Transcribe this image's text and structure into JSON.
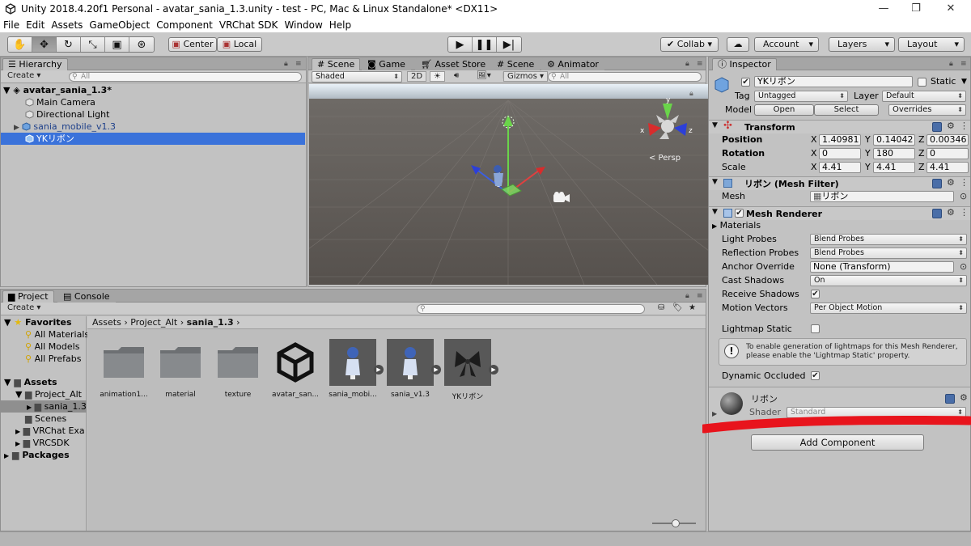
{
  "window": {
    "title": "Unity 2018.4.20f1 Personal - avatar_sania_1.3.unity - test - PC, Mac & Linux Standalone* <DX11>"
  },
  "menu": [
    "File",
    "Edit",
    "Assets",
    "GameObject",
    "Component",
    "VRChat SDK",
    "Window",
    "Help"
  ],
  "toolbar": {
    "center_label": "Center",
    "local_label": "Local",
    "collab_label": "Collab ▾",
    "account_label": "Account",
    "layers_label": "Layers",
    "layout_label": "Layout"
  },
  "hierarchy": {
    "tab": "Hierarchy",
    "create": "Create ▾",
    "search_placeholder": "All",
    "scene": "avatar_sania_1.3*",
    "items": [
      {
        "label": "Main Camera"
      },
      {
        "label": "Directional Light"
      },
      {
        "label": "sania_mobile_v1.3"
      },
      {
        "label": "YKリボン"
      }
    ]
  },
  "scene": {
    "tabs": [
      "Scene",
      "Game",
      "Asset Store",
      "Scene",
      "Animator"
    ],
    "shading": "Shaded",
    "mode2d": "2D",
    "gizmos": "Gizmos ▾",
    "search_placeholder": "All",
    "persp": "< Persp",
    "axis_x": "x",
    "axis_y": "y",
    "axis_z": "z"
  },
  "project": {
    "tabs": [
      "Project",
      "Console"
    ],
    "create": "Create ▾",
    "favorites": "Favorites",
    "fav_items": [
      "All Materials",
      "All Models",
      "All Prefabs"
    ],
    "assets_root": "Assets",
    "tree": [
      "Project_Alt",
      "sania_1.3",
      "Scenes",
      "VRChat Exa",
      "VRCSDK"
    ],
    "packages": "Packages",
    "breadcrumb": [
      "Assets",
      "Project_Alt",
      "sania_1.3"
    ],
    "assets": [
      {
        "label": "animation1...",
        "kind": "folder"
      },
      {
        "label": "material",
        "kind": "folder"
      },
      {
        "label": "texture",
        "kind": "folder"
      },
      {
        "label": "avatar_san...",
        "kind": "unity"
      },
      {
        "label": "sania_mobi...",
        "kind": "model"
      },
      {
        "label": "sania_v1.3",
        "kind": "model"
      },
      {
        "label": "YKリボン",
        "kind": "ribbon"
      }
    ]
  },
  "inspector": {
    "tab": "Inspector",
    "object_name": "YKリボン",
    "static_label": "Static",
    "tag_label": "Tag",
    "tag_value": "Untagged",
    "layer_label": "Layer",
    "layer_value": "Default",
    "model_label": "Model",
    "open_btn": "Open",
    "select_btn": "Select",
    "overrides_btn": "Overrides",
    "transform": {
      "title": "Transform",
      "position_label": "Position",
      "rotation_label": "Rotation",
      "scale_label": "Scale",
      "position": [
        "1.40981",
        "0.14042",
        "0.00346"
      ],
      "rotation": [
        "0",
        "180",
        "0"
      ],
      "scale": [
        "4.41",
        "4.41",
        "4.41"
      ],
      "axes": [
        "X",
        "Y",
        "Z"
      ]
    },
    "mesh_filter": {
      "title": "リボン (Mesh Filter)",
      "mesh_label": "Mesh",
      "mesh_value": "リボン"
    },
    "mesh_renderer": {
      "title": "Mesh Renderer",
      "materials": "Materials",
      "light_probes_label": "Light Probes",
      "light_probes": "Blend Probes",
      "reflection_probes_label": "Reflection Probes",
      "reflection_probes": "Blend Probes",
      "anchor_override_label": "Anchor Override",
      "anchor_override": "None (Transform)",
      "cast_shadows_label": "Cast Shadows",
      "cast_shadows": "On",
      "receive_shadows_label": "Receive Shadows",
      "motion_vectors_label": "Motion Vectors",
      "motion_vectors": "Per Object Motion",
      "lightmap_static_label": "Lightmap Static",
      "info_line1": "To enable generation of lightmaps for this Mesh Renderer,",
      "info_line2": "please enable the 'Lightmap Static' property.",
      "dynamic_occluded_label": "Dynamic Occluded"
    },
    "material": {
      "name": "リボン",
      "shader_label": "Shader",
      "shader_value": "Standard"
    },
    "add_component": "Add Component"
  }
}
